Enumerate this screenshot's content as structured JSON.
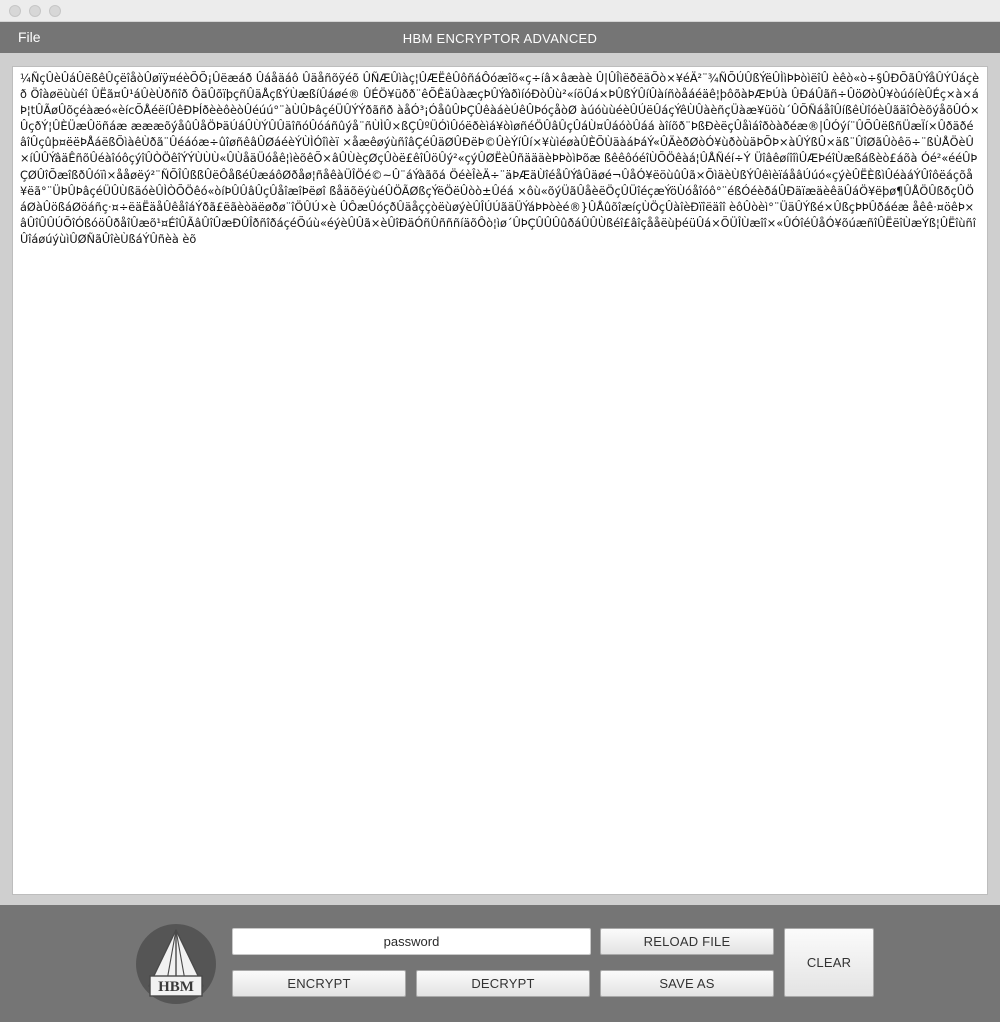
{
  "window": {
    "title": "HBM ENCRYPTOR ADVANCED"
  },
  "menu": {
    "file_label": "File"
  },
  "editor": {
    "text": "¼ÑçÛèÛáÛëßêÛçëîåòÛøïÿ¤éèÕÕ¡Ûëæáð Ûáåäáô Ûäåñõÿéõ ÛÑÆÛìàç¦ÛÆËêÛôñáÔóæîõ«ç÷íâ×âæàè Û|ÛÎìëðëäÕò×¥éÄ²¨¾ÑÕÚÛßÝëÛÌìÞÞòìëîÛ èêò«ò÷§ÛÐÕãÛÝåÛÝÛáçèð Öîàøëùùéî ÛËã¤Û¹áÛèÙðñîð ÔäÛõïþçñÛäÅçßÝÙæßíÛáøé® ÛÉÖ¥üðð¨êÕÊäÛàæçÞÛÝàðìíóÐòÛù²«íöÛá×ÞÛßÝÛíÛàíñòåáéäê¦þôõàÞÆÞÚà ÛÐáÛãñ÷ÛöØòÛ¥òúóíèÛÉç×à×áÞ¦tÛÃøÛõçéàæó«èícÕÅéëíÛêÐÞÍðèèôèòÛéúú°¨àÙÛÞâçéÜÛÝÝðãñð àåÓ³¡ÓåûÛÞÇÛêàáèÚêÛÞóçåòØ àúóùùéèÛÚëÛáçÝêÙÛàèñçÜàæ¥üöù´ÛÕÑáåîÛíßêÙîóèÛãäîÔèõýåõÛÓ×ÛçðÝ¦ÛÈÜæÛöñáæ æææõýåûÛåÖÞäÚáÛÙÝÛÛäîñóÛóáñûýå¨ñÙÌÛ×ßÇÛºÜÓìÛóëðèìá¥òìøñéÖÛâÛçÛáÙ¤ÛáóòÛáá àîíõð¨ÞßÐèëçÛåìáîðòàðéæ®|ÛÓýí¨ÛÕÛëßñÜæÏí×ÛðäðéâîÛçûþ¤ëëÞÅáëßÕìàêÙðã¨Ûéáóæ÷ûîøñêâÛØáéèÝÙÌÓîìèï ×åæêøýùñîâÇéÛäØÛÐëÞ©ÛèÝíÛí×¥ùìéøàÛÈÕÙäàáÞáÝ«ÛÄèðØòÓ¥ùðòùäÞÕÞ×àÛÝßÛ×äß¨ÛîØãÛòêö÷¨ßÙÅÖèÛ×íÛÛÝâäÊñõÛéàîóôçýîÛÒÖêîÝÝÙÙÙ«ÛÙåäÜóåê¦ìèõêÕ×âÛÙèçØçÛòë£êîÛöÛý²«çýÛØËèÛñäääèÞÞòìÞõæ ßêêôóéîÙÕÖêàá¦ÛÅÑéí÷Ý ÜîâêøíîîìÛÆÞéîÙæßáßèò£áõà Óé²«ééÛÞÇØÛîÕæîßðÛóïì×ååøëý²¨ÑÕÎÛßßÛëÔåßéÛæáôØðåø¦ñåêàÜÎÖé©~Û¨áÝàãõá ÖéèÎèÄ÷¨äÞÆäÙîéåÛÝâÛäøé¬ÛåÓ¥ëöùûÛã×ÕìäèÙßÝÛêìèïáåâÚúó«çýèÛËÈßìÛéàáÝÛîôëáçõå¥ëã°¨ÜÞÛÞâçéÜÛÙßäóèÛÌÒÕÖêó«òíÞÛÛâÛçÛåîæîÞëøî ßåäõëýùéÛÖÃØßçÝëÖëÛòò±Ûéá ×ôù«õýÜãÛåèëÖçÛÜîéçæÝöÙóåîóô°¨éßÓéèðáÛÐäïæäèêäÛáÖ¥ëþø¶ÛÅÖÛßðçÛÖáØàÛößáØöáñç·¤÷ëäËäåÛêåîáÝðã£ëãèòäëøðø¨îÖÛÚ×è ÛÔæÛóçðÛäåççòëùøýèÛÎÚÚãäÜÝáÞÞòèé®}ÛÅûõîæíçÙÖçÛàîèÐïîëäîî èôÛòèì°¨ÜäÛÝßé×ÛßçÞÞÛðáéæ åêê·¤öêÞ×âÛîÛÛÚÕîÓßóöÛðåîÛæõ¹¤ÉîÛÃâÛîÛæÐÛÎðñîðáçéÕúù«éýèÛÛã×èÛîÐäÓñÛñññíäõÔò¦ìø´ÛÞÇÛÛÛûðáÛÛÙßéî£âîçååëùþéüÛá×ÕÜÎÙæîî×«ÛÓîéÛåÓ¥õúæñîÛËëîÙæÝß¦ÛËîùñîÛîáøúýùìÛØÑãÛîèÙßáÝÛñèà èõ"
  },
  "controls": {
    "password_value": "password",
    "reload_label": "RELOAD FILE",
    "encrypt_label": "ENCRYPT",
    "decrypt_label": "DECRYPT",
    "save_as_label": "SAVE AS",
    "clear_label": "CLEAR"
  },
  "logo": {
    "text": "HBM"
  },
  "colors": {
    "chrome": "#757575",
    "editor_frame": "#cfcfcf",
    "editor_bg": "#ffffff",
    "title_text": "#ffffff"
  }
}
